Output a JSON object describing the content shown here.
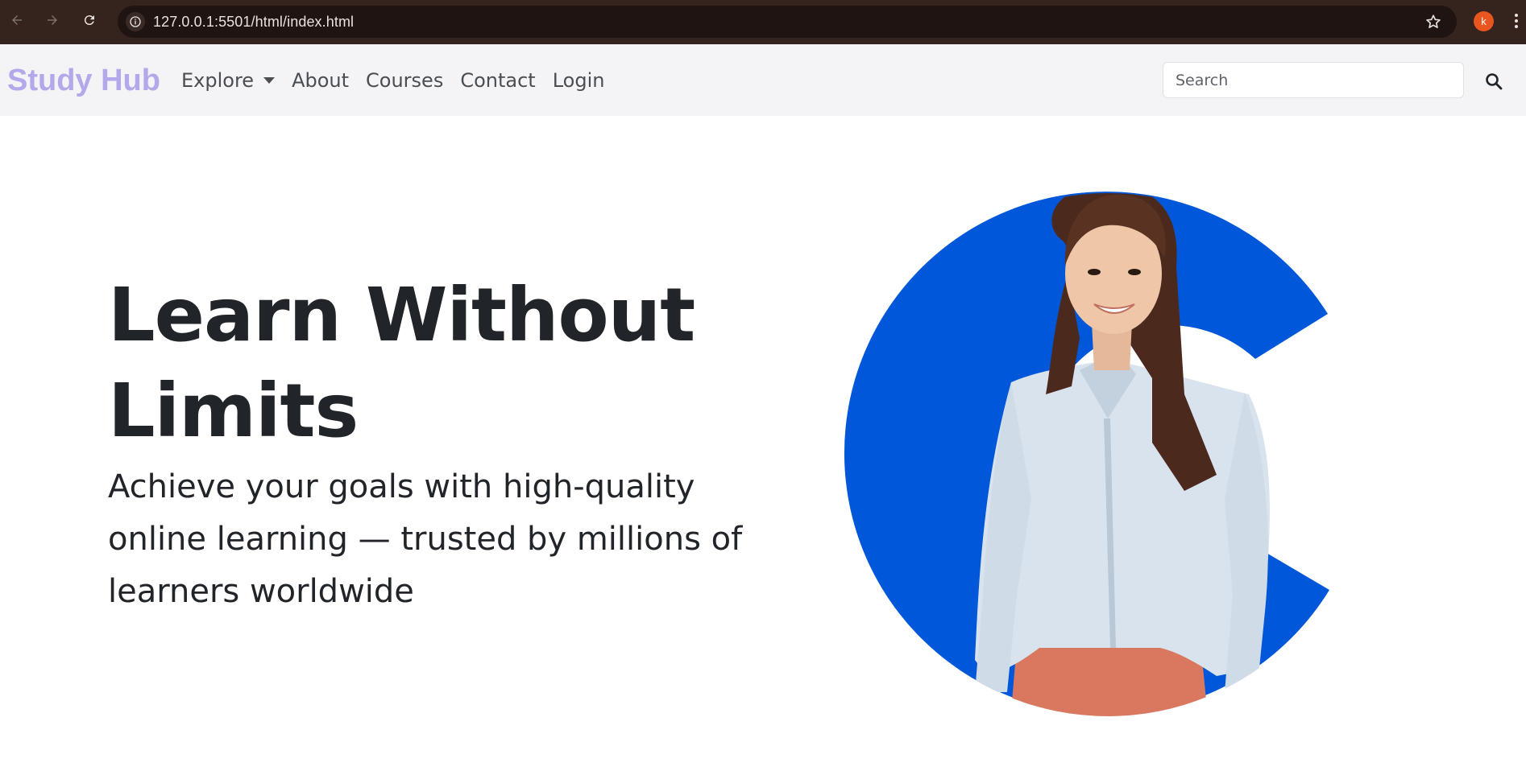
{
  "browser": {
    "url": "127.0.0.1:5501/html/index.html",
    "profile_initial": "k",
    "icons": {
      "back": "arrow-left-icon",
      "forward": "arrow-right-icon",
      "reload": "reload-icon",
      "site_info": "info-icon",
      "bookmark": "star-icon",
      "menu": "kebab-menu-icon"
    }
  },
  "navbar": {
    "brand": "Study Hub",
    "links": [
      {
        "label": "Explore",
        "dropdown": true
      },
      {
        "label": "About"
      },
      {
        "label": "Courses"
      },
      {
        "label": "Contact"
      },
      {
        "label": "Login"
      }
    ],
    "search_placeholder": "Search",
    "search_icon": "search-icon"
  },
  "hero": {
    "title": "Learn Without Limits",
    "subtitle": "Achieve your goals with high-quality online learning — trusted by millions of learners worldwide"
  },
  "colors": {
    "chrome_bg": "#35231e",
    "navbar_bg": "#f4f4f6",
    "brand": "#b3a8ea",
    "accent_blue": "#0057d9",
    "text": "#212529",
    "profile": "#e8551f"
  }
}
